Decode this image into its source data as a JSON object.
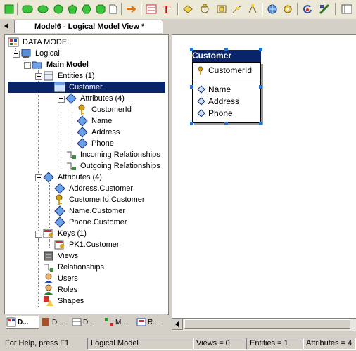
{
  "window": {
    "tab_title": "Model6 - Logical Model View *"
  },
  "tree": {
    "root": "DATA MODEL",
    "logical": "Logical",
    "main_model": "Main Model",
    "entities": "Entities (1)",
    "customer": "Customer",
    "attributes_group": "Attributes (4)",
    "attr_customerid": "CustomerId",
    "attr_name": "Name",
    "attr_address": "Address",
    "attr_phone": "Phone",
    "incoming": "Incoming Relationships",
    "outgoing": "Outgoing Relationships",
    "model_attributes": "Attributes (4)",
    "ma_address": "Address.Customer",
    "ma_customerid": "CustomerId.Customer",
    "ma_name": "Name.Customer",
    "ma_phone": "Phone.Customer",
    "keys": "Keys (1)",
    "pk1": "PK1.Customer",
    "views": "Views",
    "relationships": "Relationships",
    "users": "Users",
    "roles": "Roles",
    "shapes": "Shapes"
  },
  "bottom_tabs": [
    "D...",
    "D...",
    "D...",
    "M...",
    "R..."
  ],
  "diagram": {
    "entity_name": "Customer",
    "key_attribute": "CustomerId",
    "attributes": [
      "Name",
      "Address",
      "Phone"
    ]
  },
  "status": {
    "help": "For Help, press F1",
    "model": "Logical Model",
    "views": "Views = 0",
    "entities": "Entities = 1",
    "attributes": "Attributes = 4"
  },
  "colors": {
    "selection": "#0a246a",
    "handle": "#1e6fd9",
    "folder": "#f2c94c",
    "attribute": "#6aa0e8",
    "key": "#d4a017"
  }
}
